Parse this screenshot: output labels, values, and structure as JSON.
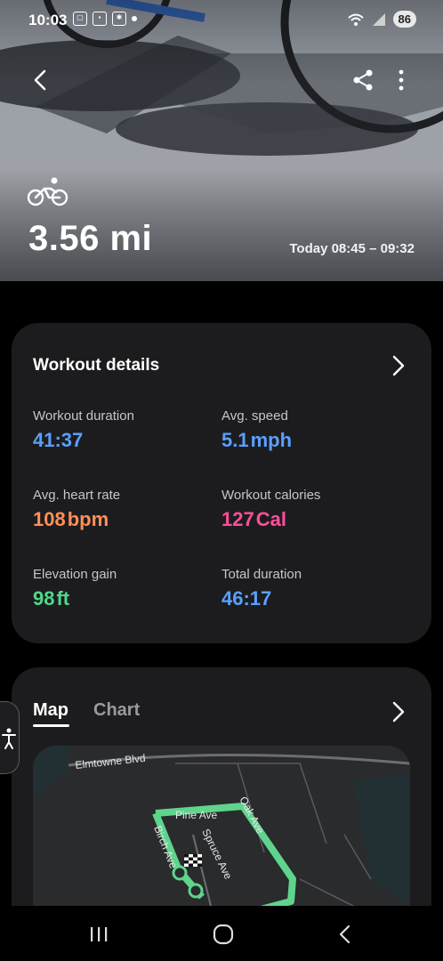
{
  "status_bar": {
    "time": "10:03",
    "battery": "86"
  },
  "hero": {
    "activity_icon": "bicycle-icon",
    "distance": "3.56 mi",
    "time_range": "Today 08:45 – 09:32"
  },
  "workout_details": {
    "title": "Workout details",
    "stats": [
      {
        "label": "Workout duration",
        "value": "41:37",
        "unit": "",
        "color": "#5aa0ff"
      },
      {
        "label": "Avg. speed",
        "value": "5.1",
        "unit": "mph",
        "color": "#5aa0ff"
      },
      {
        "label": "Avg. heart rate",
        "value": "108",
        "unit": "bpm",
        "color": "#ff8f57"
      },
      {
        "label": "Workout calories",
        "value": "127",
        "unit": "Cal",
        "color": "#ff4f9a"
      },
      {
        "label": "Elevation gain",
        "value": "98",
        "unit": "ft",
        "color": "#4fd88a"
      },
      {
        "label": "Total duration",
        "value": "46:17",
        "unit": "",
        "color": "#5aa0ff"
      }
    ]
  },
  "map_card": {
    "tabs": [
      "Map",
      "Chart"
    ],
    "active_tab": "Map",
    "streets": [
      "Elmtowne Blvd",
      "Pine Ave",
      "Oak Ave",
      "Birch Ave",
      "Spruce Ave"
    ],
    "route_color": "#5fd48c"
  }
}
